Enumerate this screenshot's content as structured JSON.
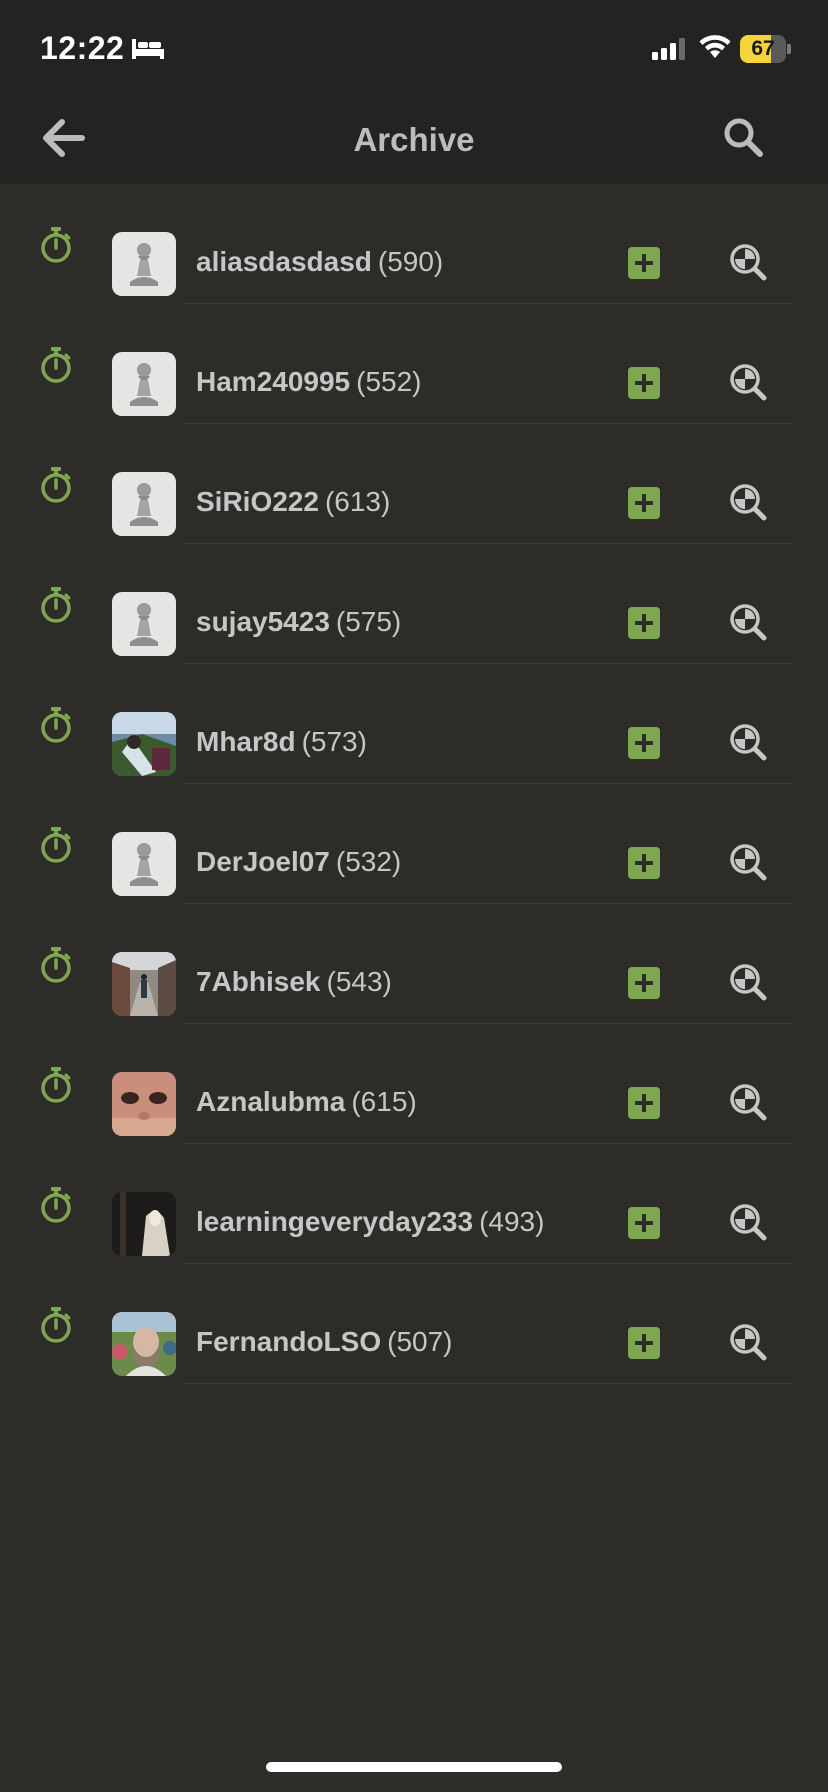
{
  "status": {
    "time": "12:22",
    "battery": "67",
    "battery_level": 0.67,
    "icons": [
      "bed-icon",
      "signal-icon",
      "wifi-icon",
      "battery-icon"
    ]
  },
  "header": {
    "title": "Archive",
    "back_icon": "arrow-left-icon",
    "search_icon": "search-icon"
  },
  "colors": {
    "background": "#2d2c29",
    "bar": "#242321",
    "accent_green": "#7fa650",
    "text": "#c6c6c6"
  },
  "games": [
    {
      "username": "aliasdasdasd",
      "rating": "(590)",
      "avatar": "pawn"
    },
    {
      "username": "Ham240995",
      "rating": "(552)",
      "avatar": "pawn"
    },
    {
      "username": "SiRiO222",
      "rating": "(613)",
      "avatar": "pawn"
    },
    {
      "username": "sujay5423",
      "rating": "(575)",
      "avatar": "pawn"
    },
    {
      "username": "Mhar8d",
      "rating": "(573)",
      "avatar": "photo-outdoor"
    },
    {
      "username": "DerJoel07",
      "rating": "(532)",
      "avatar": "pawn"
    },
    {
      "username": "7Abhisek",
      "rating": "(543)",
      "avatar": "photo-street"
    },
    {
      "username": "Aznalubma",
      "rating": "(615)",
      "avatar": "photo-face"
    },
    {
      "username": "learningeveryday233",
      "rating": "(493)",
      "avatar": "photo-dark"
    },
    {
      "username": "FernandoLSO",
      "rating": "(507)",
      "avatar": "photo-portrait"
    }
  ]
}
